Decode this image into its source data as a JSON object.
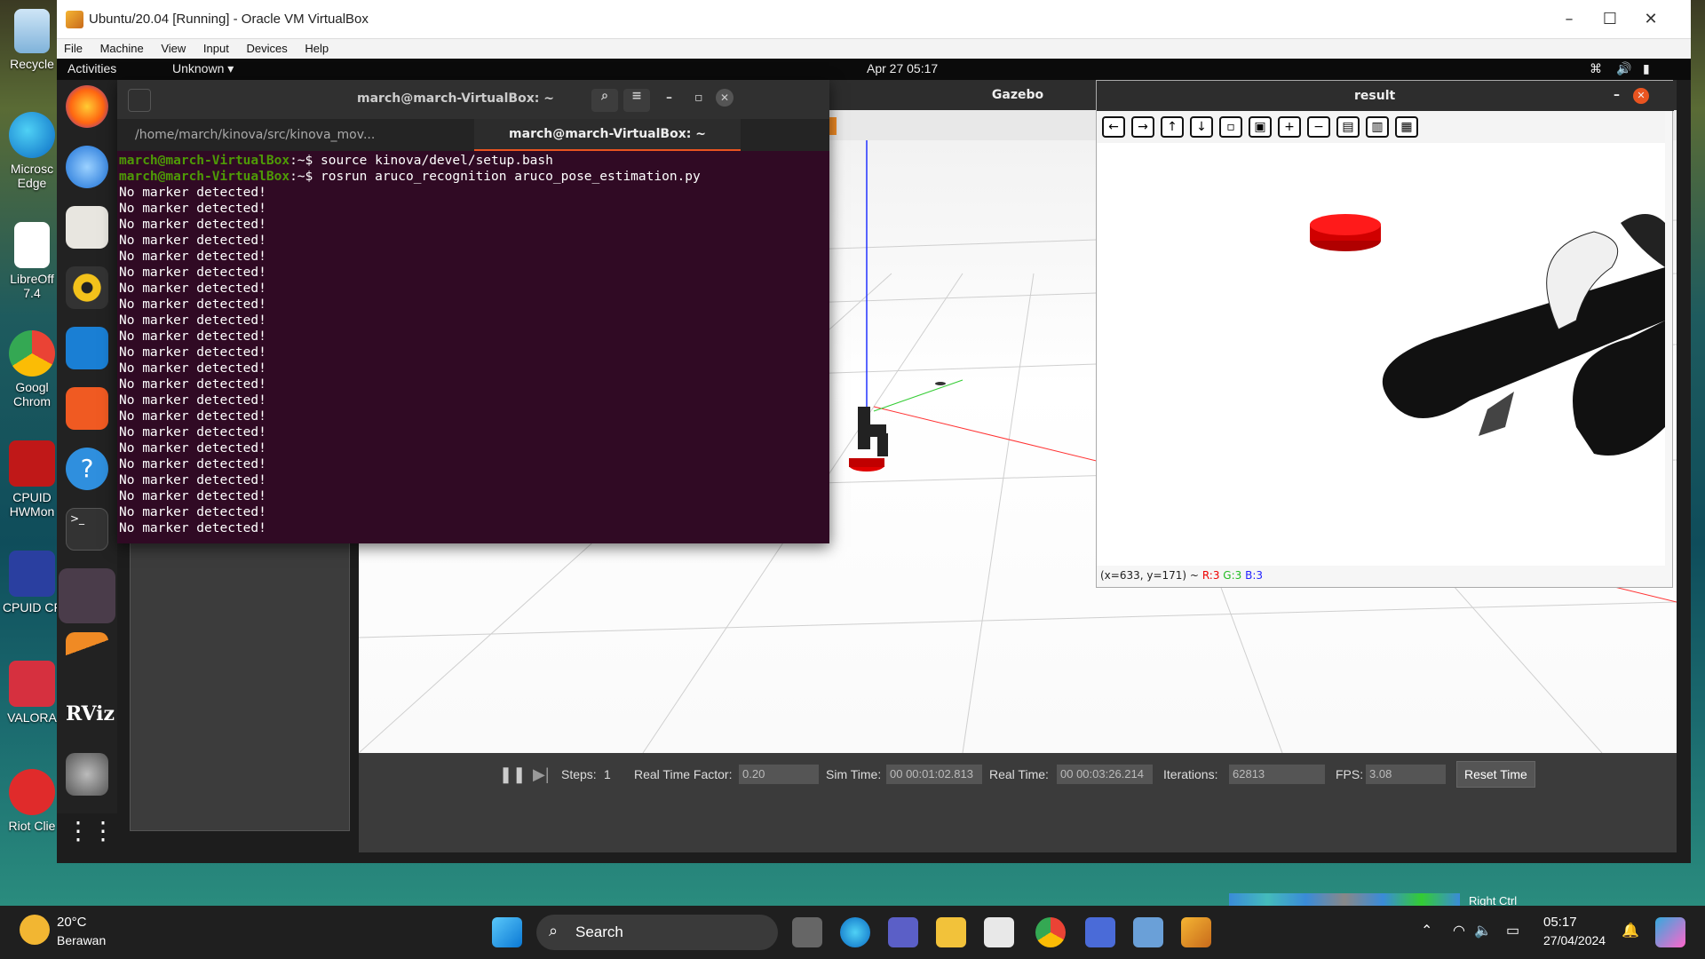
{
  "desktop": {
    "icons": [
      {
        "label": "Recycle"
      },
      {
        "label": "Microsc\nEdge"
      },
      {
        "label": "LibreOff\n7.4"
      },
      {
        "label": "Googl\nChrom"
      },
      {
        "label": "CPUID\nHWMon"
      },
      {
        "label": "CPUID CF"
      },
      {
        "label": "VALORA"
      },
      {
        "label": "Riot Clie"
      }
    ]
  },
  "vm": {
    "title": "Ubuntu/20.04 [Running] - Oracle VM VirtualBox",
    "menu": [
      "File",
      "Machine",
      "View",
      "Input",
      "Devices",
      "Help"
    ],
    "host_key": "Right Ctrl"
  },
  "ubuntu": {
    "activities": "Activities",
    "app_menu": "Unknown ▾",
    "clock": "Apr 27  05:17"
  },
  "terminal": {
    "title": "march@march-VirtualBox: ~",
    "tabs": [
      "/home/march/kinova/src/kinova_mov...",
      "march@march-VirtualBox: ~"
    ],
    "lines": [
      {
        "prompt": "march@march-VirtualBox",
        "cmd": ":~$ source kinova/devel/setup.bash"
      },
      {
        "prompt": "march@march-VirtualBox",
        "cmd": ":~$ rosrun aruco_recognition aruco_pose_estimation.py"
      }
    ],
    "output_line": "No marker detected!",
    "output_count": 22
  },
  "gazebo": {
    "title": "Gazebo",
    "steps_label": "Steps:",
    "steps_value": "1",
    "rtf_label": "Real Time Factor:",
    "rtf_value": "0.20",
    "sim_label": "Sim Time:",
    "sim_value": "00 00:01:02.813",
    "real_label": "Real Time:",
    "real_value": "00 00:03:26.214",
    "iter_label": "Iterations:",
    "iter_value": "62813",
    "fps_label": "FPS:",
    "fps_value": "3.08",
    "reset_label": "Reset Time"
  },
  "result": {
    "title": "result",
    "status_prefix": "(x=633, y=171) ~",
    "r": "R:3",
    "g": "G:3",
    "b": "B:3"
  },
  "taskbar": {
    "weather_temp": "20°C",
    "weather_desc": "Berawan",
    "search": "Search",
    "time": "05:17",
    "date": "27/04/2024"
  },
  "colors": {
    "terminal_bg": "#300a24",
    "prompt_green": "#4e9a06",
    "ubuntu_orange": "#e95420",
    "cylinder_red": "#e00000"
  }
}
